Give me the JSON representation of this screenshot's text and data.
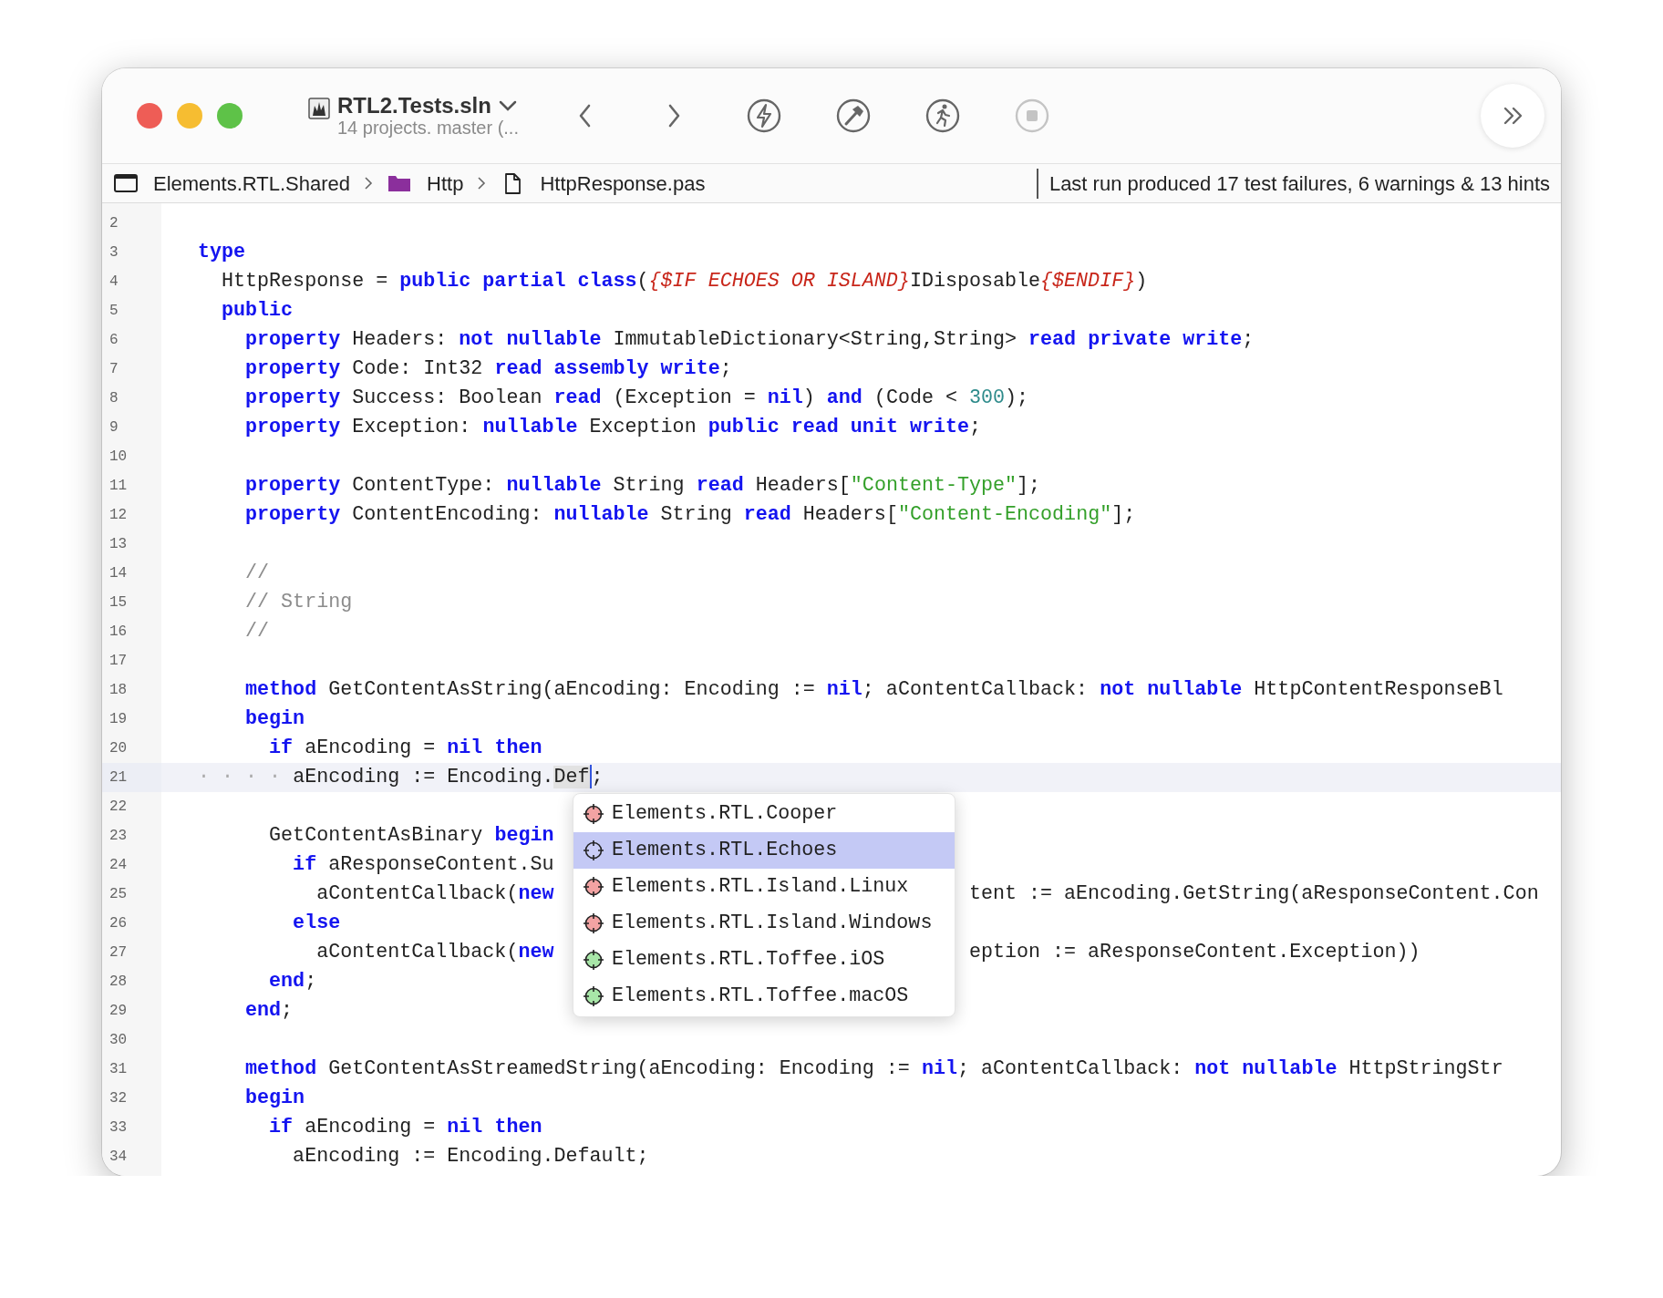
{
  "window": {
    "title": "RTL2.Tests.sln",
    "subtitle": "14 projects. master (..."
  },
  "toolbar": [
    {
      "kind": "back",
      "disabled": false
    },
    {
      "kind": "forward",
      "disabled": false
    },
    {
      "kind": "build-run",
      "disabled": false
    },
    {
      "kind": "build",
      "disabled": false
    },
    {
      "kind": "run",
      "disabled": false
    },
    {
      "kind": "stop",
      "disabled": true
    },
    {
      "kind": "more",
      "disabled": false
    }
  ],
  "breadcrumb": [
    {
      "kind": "project",
      "label": "Elements.RTL.Shared"
    },
    {
      "kind": "folder",
      "label": "Http"
    },
    {
      "kind": "file",
      "label": "HttpResponse.pas"
    }
  ],
  "status": "Last run produced 17 test failures, 6 warnings & 13 hints",
  "editor": {
    "lines": [
      {
        "number": "2",
        "current": false
      },
      {
        "number": "3",
        "current": false,
        "tokens": [
          {
            "kind": "keyword",
            "text": "type"
          }
        ]
      },
      {
        "number": "4",
        "current": false,
        "tokens": [
          {
            "kind": "plain",
            "text": "  HttpResponse = "
          },
          {
            "kind": "keyword",
            "text": "public partial class"
          },
          {
            "kind": "plain",
            "text": "("
          },
          {
            "kind": "directive",
            "text": "{$IF ECHOES OR ISLAND}"
          },
          {
            "kind": "plain",
            "text": "IDisposable"
          },
          {
            "kind": "directive",
            "text": "{$ENDIF}"
          },
          {
            "kind": "plain",
            "text": ")"
          }
        ]
      },
      {
        "number": "5",
        "current": false,
        "tokens": [
          {
            "kind": "keyword",
            "text": "  public"
          }
        ]
      },
      {
        "number": "6",
        "current": false,
        "tokens": [
          {
            "kind": "keyword",
            "text": "    property"
          },
          {
            "kind": "plain",
            "text": " Headers: "
          },
          {
            "kind": "keyword",
            "text": "not nullable"
          },
          {
            "kind": "plain",
            "text": " ImmutableDictionary<String,String> "
          },
          {
            "kind": "keyword",
            "text": "read private write"
          },
          {
            "kind": "plain",
            "text": ";"
          }
        ]
      },
      {
        "number": "7",
        "current": false,
        "tokens": [
          {
            "kind": "keyword",
            "text": "    property"
          },
          {
            "kind": "plain",
            "text": " Code: Int32 "
          },
          {
            "kind": "keyword",
            "text": "read assembly write"
          },
          {
            "kind": "plain",
            "text": ";"
          }
        ]
      },
      {
        "number": "8",
        "current": false,
        "tokens": [
          {
            "kind": "keyword",
            "text": "    property"
          },
          {
            "kind": "plain",
            "text": " Success: Boolean "
          },
          {
            "kind": "keyword",
            "text": "read"
          },
          {
            "kind": "plain",
            "text": " (Exception = "
          },
          {
            "kind": "keyword",
            "text": "nil"
          },
          {
            "kind": "plain",
            "text": ") "
          },
          {
            "kind": "keyword",
            "text": "and"
          },
          {
            "kind": "plain",
            "text": " (Code < "
          },
          {
            "kind": "number",
            "text": "300"
          },
          {
            "kind": "plain",
            "text": ");"
          }
        ]
      },
      {
        "number": "9",
        "current": false,
        "tokens": [
          {
            "kind": "keyword",
            "text": "    property"
          },
          {
            "kind": "plain",
            "text": " Exception: "
          },
          {
            "kind": "keyword",
            "text": "nullable"
          },
          {
            "kind": "plain",
            "text": " Exception "
          },
          {
            "kind": "keyword",
            "text": "public read unit write"
          },
          {
            "kind": "plain",
            "text": ";"
          }
        ]
      },
      {
        "number": "10",
        "current": false
      },
      {
        "number": "11",
        "current": false,
        "tokens": [
          {
            "kind": "keyword",
            "text": "    property"
          },
          {
            "kind": "plain",
            "text": " ContentType: "
          },
          {
            "kind": "keyword",
            "text": "nullable"
          },
          {
            "kind": "plain",
            "text": " String "
          },
          {
            "kind": "keyword",
            "text": "read"
          },
          {
            "kind": "plain",
            "text": " Headers["
          },
          {
            "kind": "string",
            "text": "\"Content-Type\""
          },
          {
            "kind": "plain",
            "text": "];"
          }
        ]
      },
      {
        "number": "12",
        "current": false,
        "tokens": [
          {
            "kind": "keyword",
            "text": "    property"
          },
          {
            "kind": "plain",
            "text": " ContentEncoding: "
          },
          {
            "kind": "keyword",
            "text": "nullable"
          },
          {
            "kind": "plain",
            "text": " String "
          },
          {
            "kind": "keyword",
            "text": "read"
          },
          {
            "kind": "plain",
            "text": " Headers["
          },
          {
            "kind": "string",
            "text": "\"Content-Encoding\""
          },
          {
            "kind": "plain",
            "text": "];"
          }
        ]
      },
      {
        "number": "13",
        "current": false
      },
      {
        "number": "14",
        "current": false,
        "tokens": [
          {
            "kind": "comment",
            "text": "    //"
          }
        ]
      },
      {
        "number": "15",
        "current": false,
        "tokens": [
          {
            "kind": "comment",
            "text": "    // String"
          }
        ]
      },
      {
        "number": "16",
        "current": false,
        "tokens": [
          {
            "kind": "comment",
            "text": "    //"
          }
        ]
      },
      {
        "number": "17",
        "current": false
      },
      {
        "number": "18",
        "current": false,
        "tokens": [
          {
            "kind": "keyword",
            "text": "    method"
          },
          {
            "kind": "plain",
            "text": " GetContentAsString(aEncoding: Encoding := "
          },
          {
            "kind": "keyword",
            "text": "nil"
          },
          {
            "kind": "plain",
            "text": "; aContentCallback: "
          },
          {
            "kind": "keyword",
            "text": "not nullable"
          },
          {
            "kind": "plain",
            "text": " HttpContentResponseBl"
          }
        ]
      },
      {
        "number": "19",
        "current": false,
        "tokens": [
          {
            "kind": "keyword",
            "text": "    begin"
          }
        ]
      },
      {
        "number": "20",
        "current": false,
        "tokens": [
          {
            "kind": "keyword",
            "text": "      if"
          },
          {
            "kind": "plain",
            "text": " aEncoding = "
          },
          {
            "kind": "keyword",
            "text": "nil then"
          }
        ]
      },
      {
        "number": "21",
        "current": true,
        "tokens": [
          {
            "kind": "whitespace",
            "text": "· · · · "
          },
          {
            "kind": "plain",
            "text": "aEncoding := Encoding."
          },
          {
            "kind": "match",
            "text": "Def"
          },
          {
            "kind": "plain",
            "text": ";"
          }
        ]
      },
      {
        "number": "22",
        "current": false
      },
      {
        "number": "23",
        "current": false,
        "tokens": [
          {
            "kind": "plain",
            "text": "      GetContentAsBinary "
          },
          {
            "kind": "keyword",
            "text": "begin"
          }
        ]
      },
      {
        "number": "24",
        "current": false,
        "tokens": [
          {
            "kind": "keyword",
            "text": "        if"
          },
          {
            "kind": "plain",
            "text": " aResponseContent.Su"
          }
        ]
      },
      {
        "number": "25",
        "current": false,
        "tokens": [
          {
            "kind": "plain",
            "text": "          aContentCallback("
          },
          {
            "kind": "keyword",
            "text": "new"
          }
        ],
        "after_popup": [
          {
            "kind": "plain",
            "text": "tent := aEncoding.GetString(aResponseContent.Con"
          }
        ]
      },
      {
        "number": "26",
        "current": false,
        "tokens": [
          {
            "kind": "keyword",
            "text": "        else"
          }
        ]
      },
      {
        "number": "27",
        "current": false,
        "tokens": [
          {
            "kind": "plain",
            "text": "          aContentCallback("
          },
          {
            "kind": "keyword",
            "text": "new"
          }
        ],
        "after_popup": [
          {
            "kind": "plain",
            "text": "eption := aResponseContent.Exception))"
          }
        ]
      },
      {
        "number": "28",
        "current": false,
        "tokens": [
          {
            "kind": "keyword",
            "text": "      end"
          },
          {
            "kind": "plain",
            "text": ";"
          }
        ]
      },
      {
        "number": "29",
        "current": false,
        "tokens": [
          {
            "kind": "keyword",
            "text": "    end"
          },
          {
            "kind": "plain",
            "text": ";"
          }
        ]
      },
      {
        "number": "30",
        "current": false
      },
      {
        "number": "31",
        "current": false,
        "tokens": [
          {
            "kind": "keyword",
            "text": "    method"
          },
          {
            "kind": "plain",
            "text": " GetContentAsStreamedString(aEncoding: Encoding := "
          },
          {
            "kind": "keyword",
            "text": "nil"
          },
          {
            "kind": "plain",
            "text": "; aContentCallback: "
          },
          {
            "kind": "keyword",
            "text": "not nullable"
          },
          {
            "kind": "plain",
            "text": " HttpStringStr"
          }
        ]
      },
      {
        "number": "32",
        "current": false,
        "tokens": [
          {
            "kind": "keyword",
            "text": "    begin"
          }
        ]
      },
      {
        "number": "33",
        "current": false,
        "tokens": [
          {
            "kind": "keyword",
            "text": "      if"
          },
          {
            "kind": "plain",
            "text": " aEncoding = "
          },
          {
            "kind": "keyword",
            "text": "nil then"
          }
        ]
      },
      {
        "number": "34",
        "current": false,
        "tokens": [
          {
            "kind": "plain",
            "text": "        aEncoding := Encoding.Default;"
          }
        ]
      }
    ]
  },
  "completion": {
    "items": [
      {
        "label": "Elements.RTL.Cooper",
        "color": "#f3a3a3",
        "selected": false
      },
      {
        "label": "Elements.RTL.Echoes",
        "color": "#c9cdf7",
        "selected": true
      },
      {
        "label": "Elements.RTL.Island.Linux",
        "color": "#f3a3a3",
        "selected": false
      },
      {
        "label": "Elements.RTL.Island.Windows",
        "color": "#f3a3a3",
        "selected": false
      },
      {
        "label": "Elements.RTL.Toffee.iOS",
        "color": "#a8e6a8",
        "selected": false
      },
      {
        "label": "Elements.RTL.Toffee.macOS",
        "color": "#a8e6a8",
        "selected": false
      }
    ]
  }
}
